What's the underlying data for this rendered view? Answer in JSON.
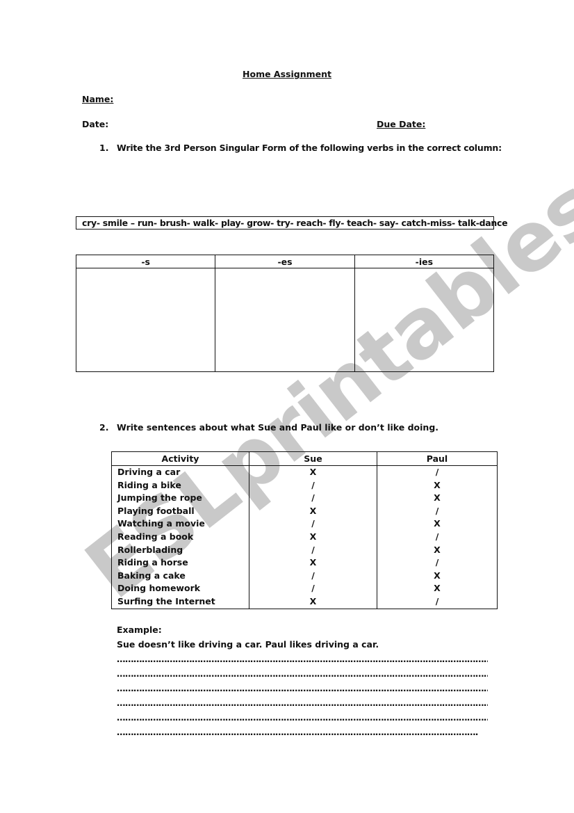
{
  "document": {
    "title": "Home Assignment",
    "name_label": "Name:",
    "date_label": "Date:",
    "due_date_label": "Due Date:",
    "watermark": "ESLprintables.com"
  },
  "exercise1": {
    "number": "1.",
    "instruction": "Write the 3rd Person Singular Form of the following verbs in the correct column:",
    "verb_list": "cry- smile – run- brush- walk- play- grow- try- reach- fly- teach- say- catch-miss- talk-dance",
    "columns": [
      "-s",
      "-es",
      "-ies"
    ]
  },
  "exercise2": {
    "number": "2.",
    "instruction": "Write sentences about what Sue and Paul like or don’t like doing.",
    "headers": [
      "Activity",
      "Sue",
      "Paul"
    ],
    "rows": [
      {
        "activity": "Driving a car",
        "sue": "X",
        "paul": "/"
      },
      {
        "activity": "Riding a bike",
        "sue": "/",
        "paul": "X"
      },
      {
        "activity": "Jumping the rope",
        "sue": "/",
        "paul": "X"
      },
      {
        "activity": "Playing football",
        "sue": "X",
        "paul": "/"
      },
      {
        "activity": "Watching a movie",
        "sue": "/",
        "paul": "X"
      },
      {
        "activity": "Reading a book",
        "sue": "X",
        "paul": "/"
      },
      {
        "activity": "Rollerblading",
        "sue": "/",
        "paul": "X"
      },
      {
        "activity": "Riding a horse",
        "sue": "X",
        "paul": "/"
      },
      {
        "activity": "Baking a cake",
        "sue": "/",
        "paul": "X"
      },
      {
        "activity": "Doing homework",
        "sue": "/",
        "paul": "X"
      },
      {
        "activity": "Surfing the Internet",
        "sue": "X",
        "paul": "/"
      }
    ],
    "example_label": "Example:",
    "example_sentence": "Sue doesn’t like driving a car. Paul likes driving a car.",
    "answer_lines": [
      "……………………………………………………………………………………………………………………………………………………………………………………",
      "……………………………………………………………………………………………………………………………………………………………………………………",
      "……………………………………………………………………………………………………………………………………………………………………………………",
      "……………………………………………………………………………………………………………………………………………………………………………………",
      "……………………………………………………………………………………………………………………………………………………………………………………",
      "……………………………………………………………………………………………………………………………………………………………………………"
    ]
  }
}
